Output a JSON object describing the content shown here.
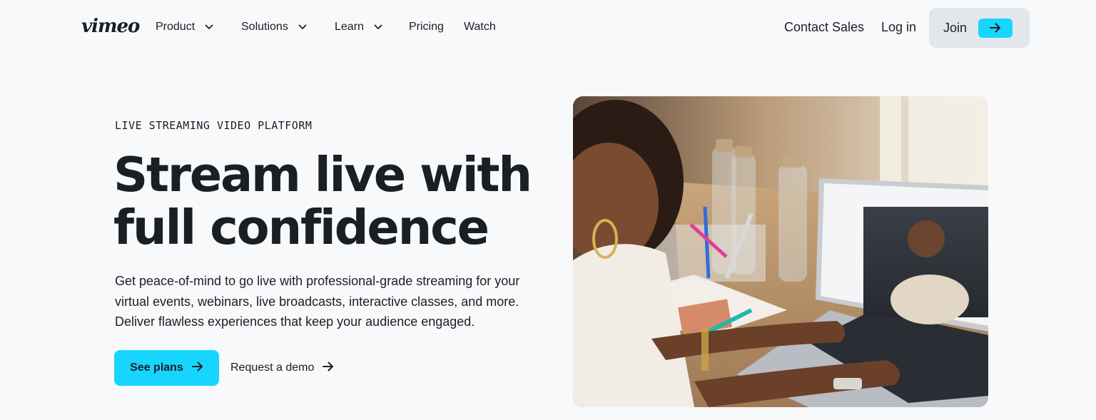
{
  "nav": {
    "logo": "vimeo",
    "items": [
      {
        "label": "Product",
        "has_dropdown": true
      },
      {
        "label": "Solutions",
        "has_dropdown": true
      },
      {
        "label": "Learn",
        "has_dropdown": true
      },
      {
        "label": "Pricing",
        "has_dropdown": false
      },
      {
        "label": "Watch",
        "has_dropdown": false
      }
    ],
    "contact_sales": "Contact Sales",
    "login": "Log in",
    "join": "Join",
    "join_icon": "arrow-right-icon"
  },
  "hero": {
    "eyebrow": "LIVE STREAMING VIDEO PLATFORM",
    "headline_line1": "Stream live with",
    "headline_line2": "full confidence",
    "description": "Get peace-of-mind to go live with professional-grade streaming for your virtual events, webinars, live broadcasts, interactive classes, and more. Deliver flawless experiences that keep your audience engaged.",
    "primary_cta": "See plans",
    "secondary_cta": "Request a demo",
    "image_icon": "woman-streaming-on-laptop-photo"
  },
  "colors": {
    "accent": "#17d5ff",
    "text": "#1a1f24",
    "background": "#f8f9fb",
    "join_bg": "#e3e7ec"
  }
}
